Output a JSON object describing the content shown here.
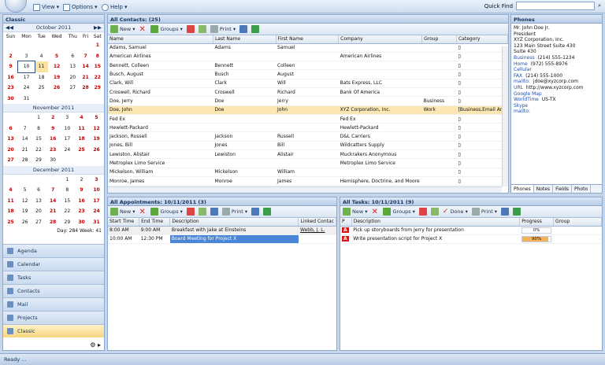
{
  "topbar": {
    "view": "View",
    "options": "Options",
    "help": "Help",
    "quick_find": "Quick Find"
  },
  "sidebar": {
    "title": "Classic",
    "day_week": "Day: 284 Week: 41",
    "months": [
      {
        "title": "October 2011",
        "rows": [
          [
            "",
            "",
            "",
            "",
            "",
            "",
            "1"
          ],
          [
            "2",
            "3",
            "4",
            "5",
            "6",
            "7",
            "8"
          ],
          [
            "9",
            "10",
            "11",
            "12",
            "13",
            "14",
            "15"
          ],
          [
            "16",
            "17",
            "18",
            "19",
            "20",
            "21",
            "22"
          ],
          [
            "23",
            "24",
            "25",
            "26",
            "27",
            "28",
            "29"
          ],
          [
            "30",
            "31",
            "",
            "",
            "",
            "",
            ""
          ]
        ]
      },
      {
        "title": "November 2011",
        "rows": [
          [
            "",
            "",
            "1",
            "2",
            "3",
            "4",
            "5"
          ],
          [
            "6",
            "7",
            "8",
            "9",
            "10",
            "11",
            "12"
          ],
          [
            "13",
            "14",
            "15",
            "16",
            "17",
            "18",
            "19"
          ],
          [
            "20",
            "21",
            "22",
            "23",
            "24",
            "25",
            "26"
          ],
          [
            "27",
            "28",
            "29",
            "30",
            "",
            "",
            ""
          ]
        ]
      },
      {
        "title": "December 2011",
        "rows": [
          [
            "",
            "",
            "",
            "",
            "1",
            "2",
            "3"
          ],
          [
            "4",
            "5",
            "6",
            "7",
            "8",
            "9",
            "10"
          ],
          [
            "11",
            "12",
            "13",
            "14",
            "15",
            "16",
            "17"
          ],
          [
            "18",
            "19",
            "20",
            "21",
            "22",
            "23",
            "24"
          ],
          [
            "25",
            "26",
            "27",
            "28",
            "29",
            "30",
            "31"
          ]
        ]
      }
    ],
    "weekdays": [
      "Sun",
      "Mon",
      "Tue",
      "Wed",
      "Thu",
      "Fri",
      "Sat"
    ],
    "nav": [
      "Agenda",
      "Calendar",
      "Tasks",
      "Contacts",
      "Mail",
      "Projects",
      "Classic"
    ]
  },
  "contacts": {
    "title": "All Contacts: (25)",
    "columns": [
      "Name",
      "Last Name",
      "First Name",
      "Company",
      "Group",
      "Category"
    ],
    "rows": [
      [
        "Adams, Samuel",
        "Adams",
        "Samuel",
        "",
        "",
        ""
      ],
      [
        "American Airlines",
        "",
        "",
        "American Airlines",
        "",
        ""
      ],
      [
        "Bennett, Colleen",
        "Bennett",
        "Colleen",
        "",
        "",
        ""
      ],
      [
        "Busch, August",
        "Busch",
        "August",
        "",
        "",
        ""
      ],
      [
        "Clark, Will",
        "Clark",
        "Will",
        "Bats Express, LLC",
        "",
        ""
      ],
      [
        "Croswell, Richard",
        "Croswell",
        "Richard",
        "Bank Of America",
        "",
        ""
      ],
      [
        "Doe, Jerry",
        "Doe",
        "Jerry",
        "",
        "Business",
        ""
      ],
      [
        "Doe, John",
        "Doe",
        "John",
        "XYZ Corporation, Inc.",
        "Work",
        "[Business,Email Ann"
      ],
      [
        "Fed Ex",
        "",
        "",
        "Fed Ex",
        "",
        ""
      ],
      [
        "Hewlett-Packard",
        "",
        "",
        "Hewlett-Packard",
        "",
        ""
      ],
      [
        "Jackson, Russell",
        "Jackson",
        "Russell",
        "D&L Carriers",
        "",
        ""
      ],
      [
        "Jones, Bill",
        "Jones",
        "Bill",
        "Wildcatters Supply",
        "",
        ""
      ],
      [
        "Lewiston, Alistair",
        "Lewiston",
        "Alistair",
        "Muckrakers Anonymous",
        "",
        ""
      ],
      [
        "Metroplex Limo Service",
        "",
        "",
        "Metroplex Limo Service",
        "",
        ""
      ],
      [
        "Mickelson, William",
        "Mickelson",
        "William",
        "",
        "",
        ""
      ],
      [
        "Monroe, James",
        "Monroe",
        "James",
        "Hemisphere, Doctrine, and Moore",
        "",
        ""
      ]
    ]
  },
  "toolbar": {
    "new": "New",
    "groups": "Groups",
    "print": "Print",
    "done": "Done"
  },
  "phones": {
    "title": "Phones",
    "lines": [
      "Mr. John Doe Jr.",
      "President",
      "XYZ Corporation, Inc.",
      "123 Main Street Suite 430",
      "Suite 430"
    ],
    "fields": [
      [
        "Business",
        "(214) 555-1234"
      ],
      [
        "Home",
        "(972) 555-8976"
      ],
      [
        "Cellular",
        ""
      ],
      [
        "FAX",
        "(214) 555-1000"
      ],
      [
        "mailto:",
        "jdoe@xyzcorp.com"
      ],
      [
        "URL",
        "http://www.xyzcorp.com"
      ],
      [
        "Google Map",
        ""
      ],
      [
        "WorldTime",
        "US-TX"
      ],
      [
        "Skype",
        ""
      ],
      [
        "mailto:",
        ""
      ]
    ],
    "tabs": [
      "Phones",
      "Notes",
      "Fields",
      "Photo"
    ]
  },
  "appointments": {
    "title": "All Appointments: 10/11/2011 (3)",
    "columns": [
      "Start Time",
      "End Time",
      "Description",
      "Linked Contac"
    ],
    "rows": [
      [
        "8:00 AM",
        "9:00 AM",
        "Breakfast with Jake at Einsteins",
        "Webb, J. L."
      ],
      [
        "10:00 AM",
        "12:30 PM",
        "Board Meeting for Project X",
        ""
      ]
    ]
  },
  "tasks": {
    "title": "All Tasks: 10/11/2011 (9)",
    "columns": [
      "P",
      "Description",
      "Progress",
      "Group"
    ],
    "rows": [
      {
        "priority": "A",
        "description": "Pick up storyboards from Jerry for presentation",
        "progress": "0%",
        "value": 0
      },
      {
        "priority": "A",
        "description": "Write presentation script for Project X",
        "progress": "90%",
        "value": 90
      }
    ]
  },
  "status": "Ready ..."
}
